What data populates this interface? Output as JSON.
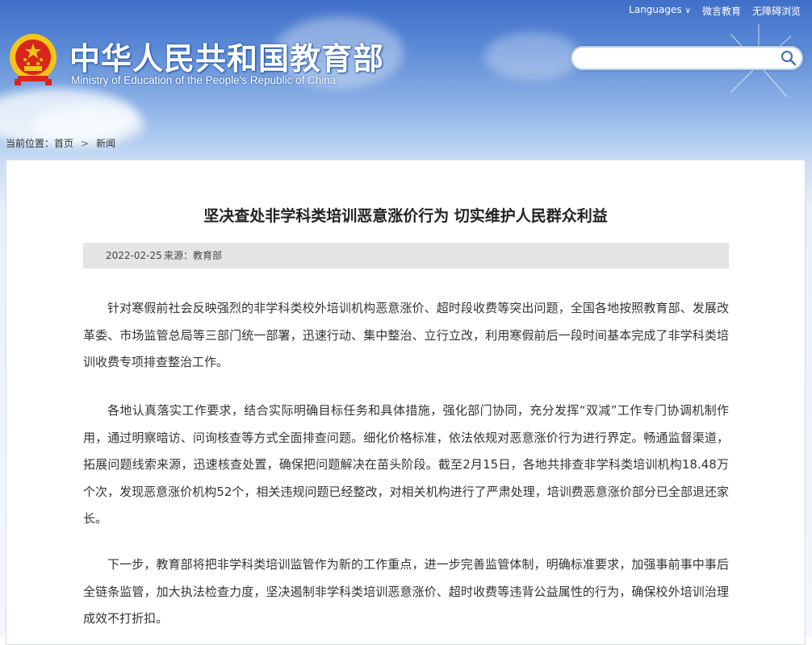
{
  "header": {
    "top_links": {
      "languages": "Languages",
      "weibo": "微言教育",
      "accessibility": "无障碍浏览"
    },
    "site_title": "中华人民共和国教育部",
    "site_subtitle": "Ministry of Education of the People's Republic of China",
    "search": {
      "value": "",
      "placeholder": ""
    }
  },
  "breadcrumb": {
    "label": "当前位置：",
    "items": [
      "首页",
      "新闻"
    ]
  },
  "article": {
    "title": "坚决查处非学科类培训恶意涨价行为 切实维护人民群众利益",
    "date": "2022-02-25",
    "source": "来源：教育部",
    "paragraphs": [
      "针对寒假前社会反映强烈的非学科类校外培训机构恶意涨价、超时段收费等突出问题，全国各地按照教育部、发展改革委、市场监管总局等三部门统一部署，迅速行动、集中整治、立行立改，利用寒假前后一段时间基本完成了非学科类培训收费专项排查整治工作。",
      "各地认真落实工作要求，结合实际明确目标任务和具体措施，强化部门协同，充分发挥“双减”工作专门协调机制作用，通过明察暗访、问询核查等方式全面排查问题。细化价格标准，依法依规对恶意涨价行为进行界定。畅通监督渠道，拓展问题线索来源，迅速核查处置，确保把问题解决在苗头阶段。截至2月15日，各地共排查非学科类培训机构18.48万个次，发现恶意涨价机构52个，相关违规问题已经整改，对相关机构进行了严肃处理，培训费恶意涨价部分已全部退还家长。",
      "下一步，教育部将把非学科类培训监管作为新的工作重点，进一步完善监管体制，明确标准要求，加强事前事中事后全链条监管，加大执法检查力度，坚决遏制非学科类培训恶意涨价、超时收费等违背公益属性的行为，确保校外培训治理成效不打折扣。"
    ]
  },
  "colors": {
    "header_blue": "#3f6fc9",
    "emblem_red": "#d9261c",
    "emblem_gold": "#f5c518",
    "meta_bar": "#e4e4e4"
  },
  "icons": {
    "emblem": "national-emblem-icon",
    "search": "search-icon",
    "languages_dropdown": "chevron-down-icon",
    "breadcrumb_separator": "chevron-right-icon"
  }
}
